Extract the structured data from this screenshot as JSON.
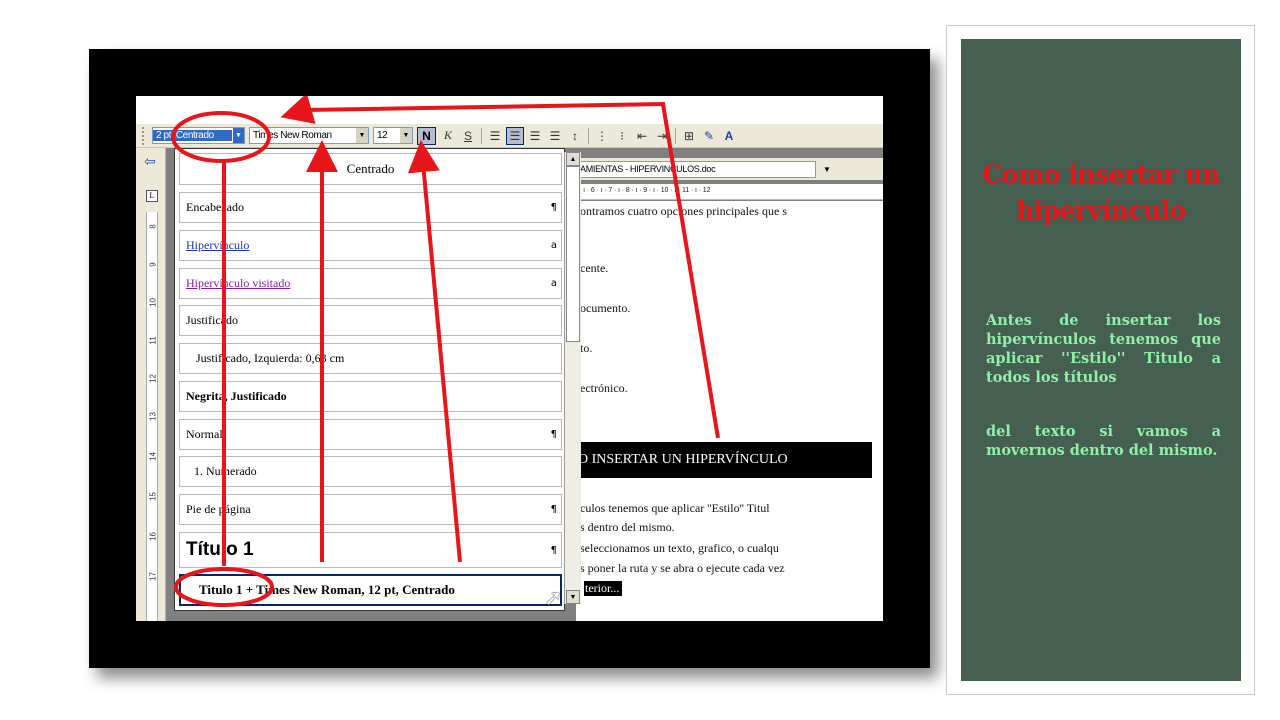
{
  "toolbar": {
    "style_value": "2 pt, Centrado",
    "font_value": "Times New Roman",
    "size_value": "12",
    "bold_label": "N",
    "italic_label": "K",
    "underline_label": "S"
  },
  "document_bar": {
    "filename": "AMIENTAS - HIPERVINCULOS.doc"
  },
  "horizontal_ruler": "· ı · 6 · ı · 7 · ı · 8 · ı · 9 · ı · 10 · ı · 11 · ı · 12",
  "vertical_ruler": [
    "8",
    "9",
    "10",
    "11",
    "12",
    "13",
    "14",
    "15",
    "16",
    "17"
  ],
  "style_list": [
    {
      "label": "Centrado",
      "kind": "centered",
      "mark": ""
    },
    {
      "label": "Encabezado",
      "kind": "normal",
      "mark": "¶"
    },
    {
      "label": "Hipervínculo",
      "kind": "link",
      "mark": "a"
    },
    {
      "label": "Hipervínculo visitado",
      "kind": "visited",
      "mark": "a"
    },
    {
      "label": "Justificado",
      "kind": "normal",
      "mark": ""
    },
    {
      "label": "Justificado, Izquierda:  0,63 cm",
      "kind": "indent",
      "mark": ""
    },
    {
      "label": "Negrita, Justificado",
      "kind": "bold",
      "mark": ""
    },
    {
      "label": "Normal",
      "kind": "normal",
      "mark": "¶"
    },
    {
      "label": "1.   Numerado",
      "kind": "indent",
      "mark": ""
    },
    {
      "label": "Pie de página",
      "kind": "normal",
      "mark": "¶"
    },
    {
      "label": "Título 1",
      "kind": "titulo",
      "mark": "¶"
    },
    {
      "label": "Titulo 1 + Times New Roman, 12 pt, Centrado",
      "kind": "selected",
      "mark": ""
    }
  ],
  "document_text": {
    "line1": "ontramos cuatro opciones principales que s",
    "line2": "cente.",
    "line3": "ocumento.",
    "line4": "to.",
    "line5": "ectrónico.",
    "heading": "O INSERTAR UN HIPERVÍNCULO",
    "line6": "culos tenemos que aplicar ''Estilo'' Titul",
    "line7": "s dentro del mismo.",
    "line8": "seleccionamos un texto, grafico, o cualqu",
    "line9": "s poner la ruta y se abra o ejecute cada vez",
    "line10": "terior..."
  },
  "side_panel": {
    "title": "Como insertar un hipervínculo",
    "paragraph1": "Antes de insertar los hipervínculos tenemos que aplicar ''Estilo'' Titulo a todos los títulos",
    "paragraph2": "del texto si vamos a movernos dentro del mismo."
  },
  "colors": {
    "annotation_red": "#e8151a",
    "panel_bg": "#455f51",
    "panel_text": "#8ff0a8",
    "panel_title": "#e8151a"
  },
  "icons": [
    "back-arrow-icon",
    "bold-icon",
    "italic-icon",
    "underline-icon",
    "align-left-icon",
    "align-center-icon",
    "align-right-icon",
    "justify-icon",
    "line-spacing-icon",
    "numbering-icon",
    "bullets-icon",
    "decrease-indent-icon",
    "increase-indent-icon",
    "border-icon",
    "highlight-icon",
    "font-color-icon",
    "mouse-cursor-icon"
  ]
}
